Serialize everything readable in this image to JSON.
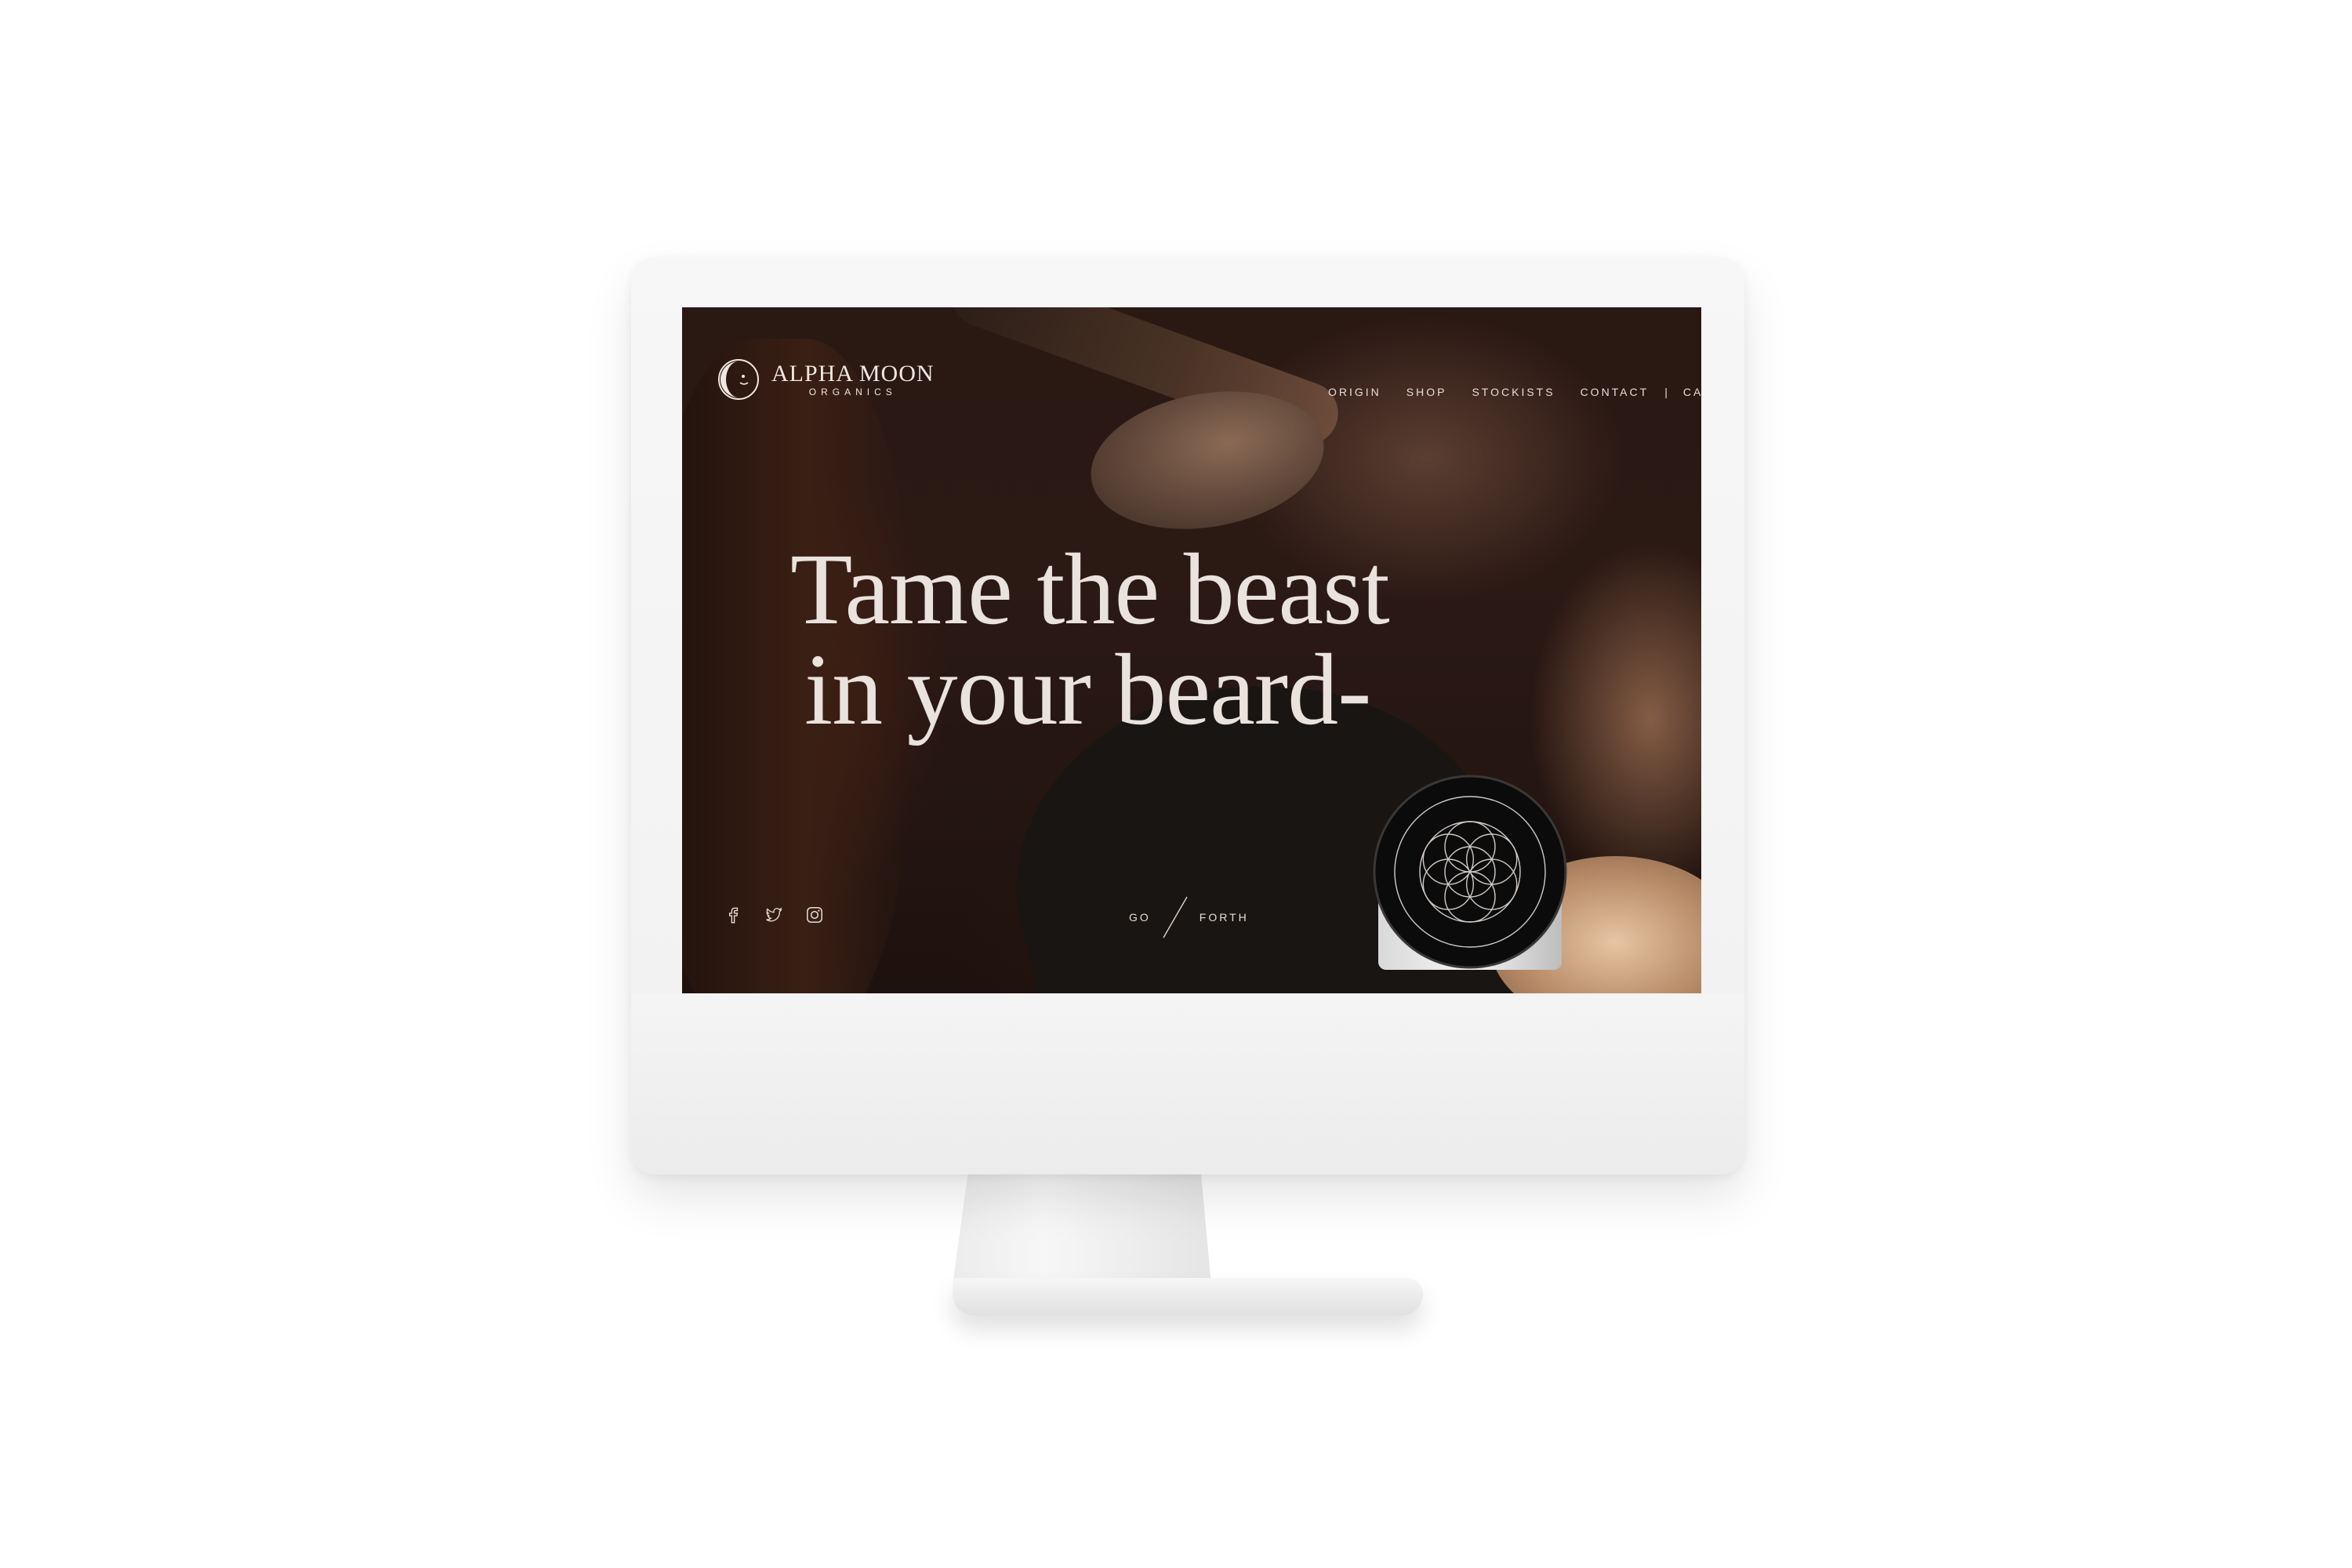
{
  "brand": {
    "name": "ALPHA MOON",
    "subtitle": "ORGANICS"
  },
  "nav": {
    "items": [
      "ORIGIN",
      "SHOP",
      "STOCKISTS",
      "CONTACT"
    ],
    "divider": "|",
    "cart": "CART"
  },
  "hero": {
    "line1": "Tame the beast",
    "line2": "in your beard-"
  },
  "cta": {
    "left": "GO",
    "right": "FORTH"
  },
  "social": [
    "facebook-icon",
    "twitter-icon",
    "instagram-icon"
  ],
  "colors": {
    "text": "#eae2dc",
    "background": "#2a1813",
    "device": "#f3f3f3"
  }
}
